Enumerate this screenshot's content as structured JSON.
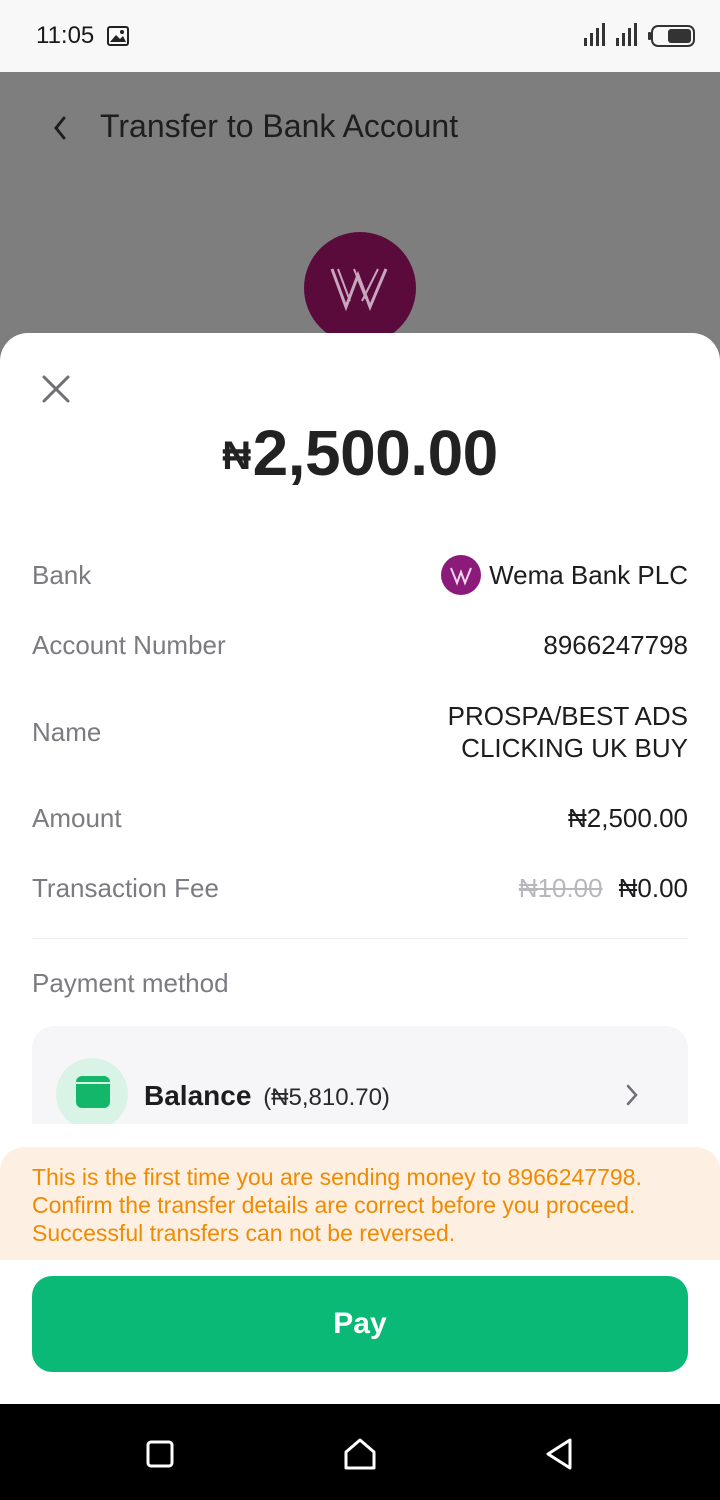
{
  "status_bar": {
    "time": "11:05"
  },
  "header": {
    "title": "Transfer to Bank Account"
  },
  "sheet": {
    "currency_symbol": "₦",
    "amount": "2,500.00",
    "details": {
      "bank_label": "Bank",
      "bank_value": "Wema Bank PLC",
      "account_label": "Account Number",
      "account_value": "8966247798",
      "name_label": "Name",
      "name_line1": "PROSPA/BEST ADS",
      "name_line2": "CLICKING UK BUY",
      "amount_label": "Amount",
      "amount_value": "₦2,500.00",
      "fee_label": "Transaction Fee",
      "fee_original": "₦10.00",
      "fee_value": "₦0.00"
    },
    "payment_method": {
      "title": "Payment method",
      "balance_label": "Balance",
      "balance_amount": "(₦5,810.70)"
    },
    "warning": "This is the first time you are sending money to 8966247798. Confirm the transfer details are correct before you proceed. Successful transfers can not be reversed.",
    "pay_label": "Pay"
  },
  "colors": {
    "primary_green": "#0ab976",
    "warning_text": "#f08a00",
    "warning_bg": "#fdf0e2",
    "bank_brand": "#5a0b3b"
  },
  "icons": {
    "status": [
      "image-icon",
      "signal-icon",
      "battery-icon"
    ],
    "header": "back-chevron-icon",
    "sheet": [
      "close-icon",
      "wallet-icon",
      "chevron-right-icon"
    ],
    "nav": [
      "recents-square-icon",
      "home-icon",
      "back-triangle-icon"
    ]
  }
}
